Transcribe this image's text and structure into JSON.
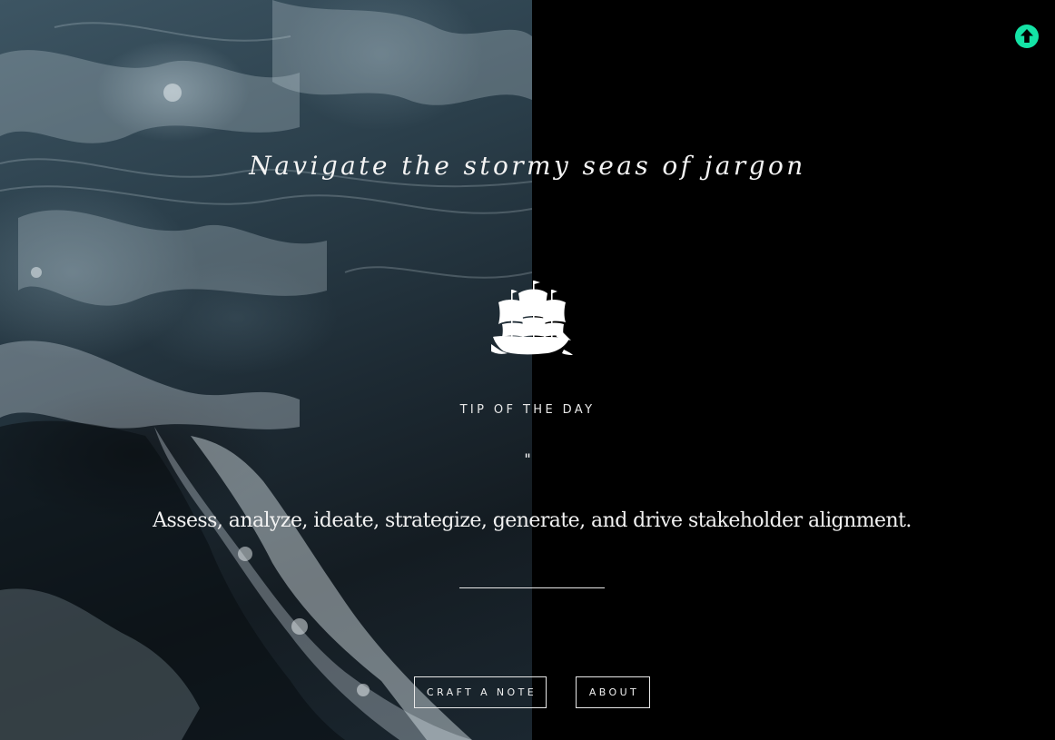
{
  "hero": {
    "headline": "Navigate the stormy seas of jargon"
  },
  "logo": {
    "icon": "ship-icon"
  },
  "tip": {
    "heading": "TIP OF THE DAY",
    "quote_mark": "\"",
    "text": "Assess, analyze, ideate, strategize, generate, and drive stakeholder alignment."
  },
  "actions": {
    "craft_label": "CRAFT A NOTE",
    "about_label": "ABOUT"
  },
  "scroll_top": {
    "icon": "arrow-up-icon",
    "color": "#14e3a6"
  },
  "colors": {
    "background": "#000000",
    "text": "#f2f2f2",
    "accent": "#14e3a6"
  }
}
